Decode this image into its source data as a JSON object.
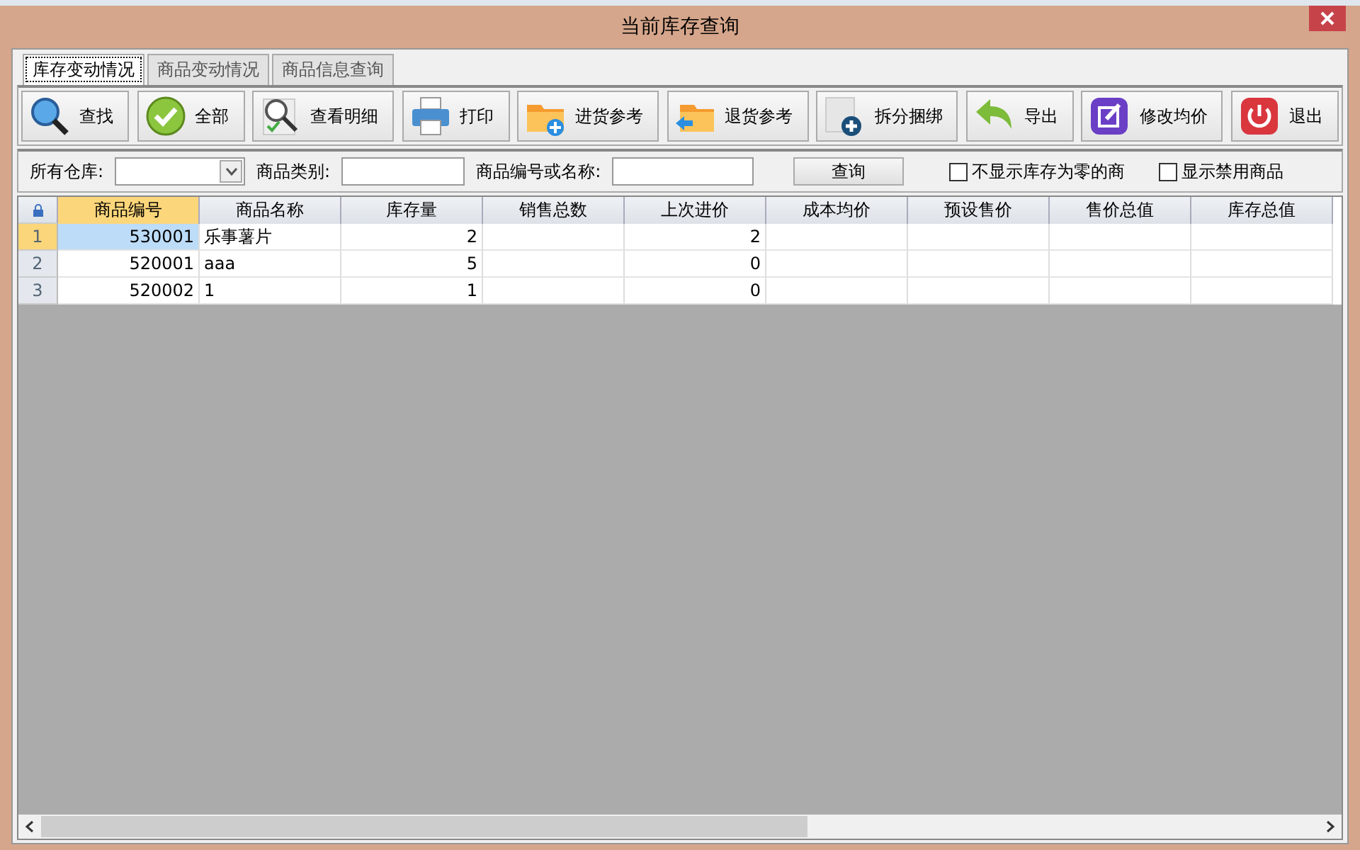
{
  "window": {
    "title": "当前库存查询"
  },
  "tabs": [
    {
      "label": "库存变动情况",
      "selected": true
    },
    {
      "label": "商品变动情况",
      "selected": false
    },
    {
      "label": "商品信息查询",
      "selected": false
    }
  ],
  "toolbar": [
    "查找",
    "全部",
    "查看明细",
    "打印",
    "进货参考",
    "退货参考",
    "拆分捆绑",
    "导出",
    "修改均价",
    "退出"
  ],
  "filters": {
    "warehouse_label": "所有仓库:",
    "category_label": "商品类别:",
    "code_label": "商品编号或名称:",
    "query_button": "查询",
    "checkboxes": [
      {
        "label": "不显示库存为零的商",
        "checked": false
      },
      {
        "label": "显示禁用商品",
        "checked": false
      }
    ]
  },
  "table": {
    "columns": [
      "商品编号",
      "商品名称",
      "库存量",
      "销售总数",
      "上次进价",
      "成本均价",
      "预设售价",
      "售价总值",
      "库存总值"
    ],
    "rows": [
      {
        "number": "1",
        "selected": true,
        "cells": [
          "530001",
          "乐事薯片",
          "2",
          "",
          "2",
          "",
          "",
          "",
          ""
        ]
      },
      {
        "number": "2",
        "selected": false,
        "cells": [
          "520001",
          "aaa",
          "5",
          "",
          "0",
          "",
          "",
          "",
          ""
        ]
      },
      {
        "number": "3",
        "selected": false,
        "cells": [
          "520002",
          "1",
          "1",
          "",
          "0",
          "",
          "",
          "",
          ""
        ]
      }
    ]
  }
}
